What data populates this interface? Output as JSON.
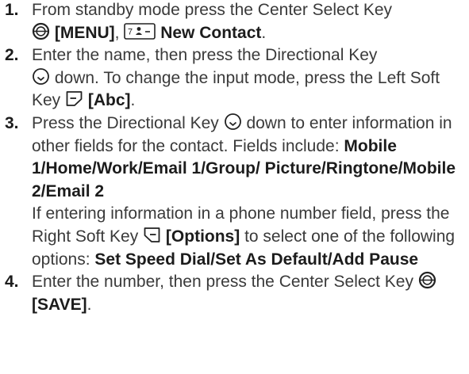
{
  "steps": [
    {
      "number": "1.",
      "parts": {
        "a": "From standby mode press the Center Select Key ",
        "b": "[MENU]",
        "c": ", ",
        "d": "New Contact",
        "e": "."
      }
    },
    {
      "number": "2.",
      "parts": {
        "a": "Enter the name, then press the Directional Key ",
        "b": " down. To change the input mode, press the Left Soft Key ",
        "c": "[Abc]",
        "d": "."
      }
    },
    {
      "number": "3.",
      "parts": {
        "a": "Press the Directional Key ",
        "b": " down to enter information in other fields for the contact. Fields include: ",
        "c": "Mobile 1/Home/Work/Email 1/Group/ Picture/Ringtone/Mobile 2/Email 2",
        "d": "If entering information in a phone number field, press the Right Soft Key ",
        "e": "[Options]",
        "f": " to select one of the following options: ",
        "g": "Set Speed Dial/Set As Default/Add Pause"
      }
    },
    {
      "number": "4.",
      "parts": {
        "a": "Enter the number, then press the Center Select Key ",
        "b": "[SAVE]",
        "c": "."
      }
    }
  ],
  "icons": {
    "center_select": "center-select-key-icon",
    "contacts_key": "contacts-key-icon",
    "directional": "directional-key-icon",
    "left_soft": "left-soft-key-icon",
    "right_soft": "right-soft-key-icon"
  },
  "colors": {
    "text": "#3a3a3a",
    "bold_text": "#1c1c1c"
  }
}
